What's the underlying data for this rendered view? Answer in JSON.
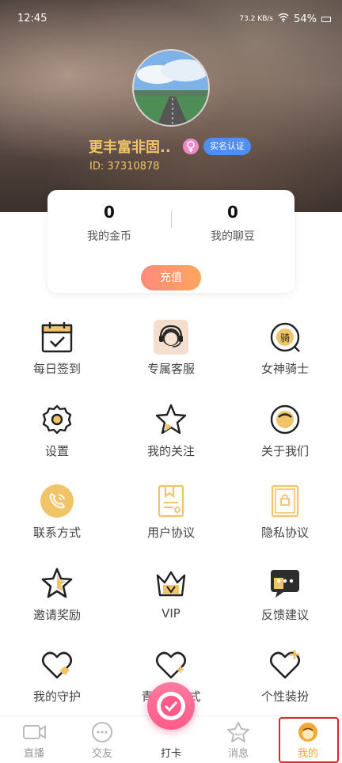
{
  "status": {
    "time": "12:45",
    "net_speed": "73.2 KB/s",
    "battery": "54%"
  },
  "profile": {
    "username": "更丰富非固..",
    "verify_label": "实名认证",
    "user_id": "ID: 37310878"
  },
  "wallet": {
    "coins_value": "0",
    "coins_label": "我的金币",
    "beans_value": "0",
    "beans_label": "我的聊豆",
    "recharge_label": "充值"
  },
  "menu": [
    {
      "label": "每日签到",
      "icon": "calendar-check-icon"
    },
    {
      "label": "专属客服",
      "icon": "customer-service-icon"
    },
    {
      "label": "女神骑士",
      "icon": "knight-badge-icon"
    },
    {
      "label": "设置",
      "icon": "gear-icon"
    },
    {
      "label": "我的关注",
      "icon": "star-icon"
    },
    {
      "label": "关于我们",
      "icon": "smile-icon"
    },
    {
      "label": "联系方式",
      "icon": "phone-icon"
    },
    {
      "label": "用户协议",
      "icon": "document-icon"
    },
    {
      "label": "隐私协议",
      "icon": "lock-document-icon"
    },
    {
      "label": "邀请奖励",
      "icon": "star-outline-icon"
    },
    {
      "label": "VIP",
      "icon": "crown-icon"
    },
    {
      "label": "反馈建议",
      "icon": "chat-bubble-icon"
    },
    {
      "label": "我的守护",
      "icon": "heart-shield-icon"
    },
    {
      "label": "青少年模式",
      "icon": "heart-plus-icon"
    },
    {
      "label": "个性装扮",
      "icon": "heart-sparkle-icon"
    }
  ],
  "tabs": {
    "live": "直播",
    "friends": "交友",
    "checkin": "打卡",
    "messages": "消息",
    "mine": "我的"
  },
  "colors": {
    "accent": "#f2a93b",
    "pink": "#ff5b8a",
    "gold_text": "#f2c46a",
    "highlight": "#e0232e"
  }
}
